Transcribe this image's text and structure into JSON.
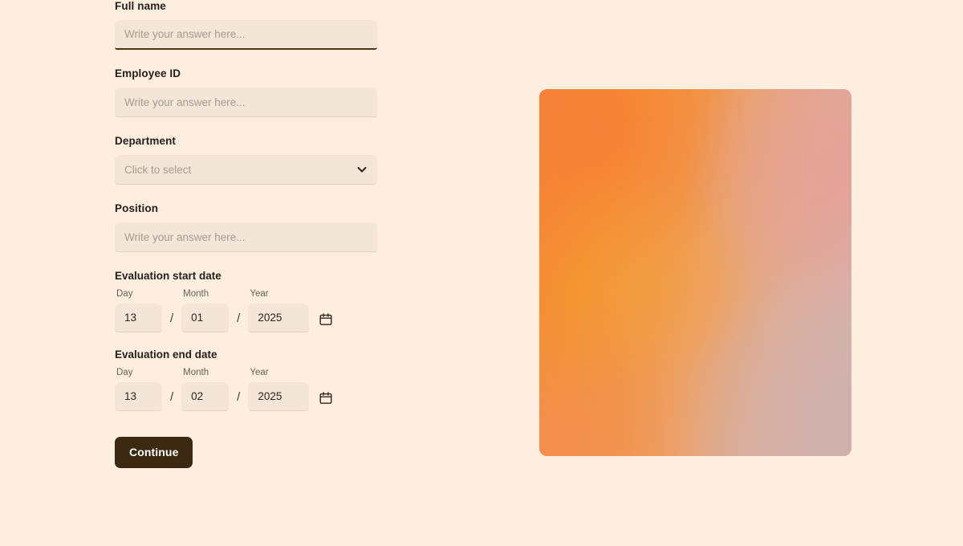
{
  "form": {
    "fields": [
      {
        "label": "Full name",
        "type": "text",
        "value": "",
        "placeholder": "Write your answer here...",
        "focused": true
      },
      {
        "label": "Employee ID",
        "type": "text",
        "value": "",
        "placeholder": "Write your answer here...",
        "focused": false
      },
      {
        "label": "Department",
        "type": "select",
        "value": "",
        "placeholder": "Click to select",
        "icon": "chevron-down-icon"
      },
      {
        "label": "Position",
        "type": "text",
        "value": "",
        "placeholder": "Write your answer here...",
        "focused": false
      }
    ],
    "dates": [
      {
        "title": "Evaluation start date",
        "day_label": "Day",
        "month_label": "Month",
        "year_label": "Year",
        "day": "13",
        "month": "01",
        "year": "2025",
        "separator": "/",
        "icon": "calendar-icon"
      },
      {
        "title": "Evaluation end date",
        "day_label": "Day",
        "month_label": "Month",
        "year_label": "Year",
        "day": "13",
        "month": "02",
        "year": "2025",
        "separator": "/",
        "icon": "calendar-icon"
      }
    ],
    "submit_label": "Continue"
  },
  "artwork": {
    "name": "gradient-artwork",
    "colors": {
      "top_left": "#F4843A",
      "top_right": "#E5A096",
      "bottom_right": "#D6B4AC",
      "bottom_left": "#F38D56"
    }
  },
  "theme": {
    "background": "#FDEEE0",
    "field_fill": "#F3E6D8",
    "accent_dark": "#3B2A11",
    "label_color": "#27211C",
    "placeholder_color": "#A89A8C"
  }
}
